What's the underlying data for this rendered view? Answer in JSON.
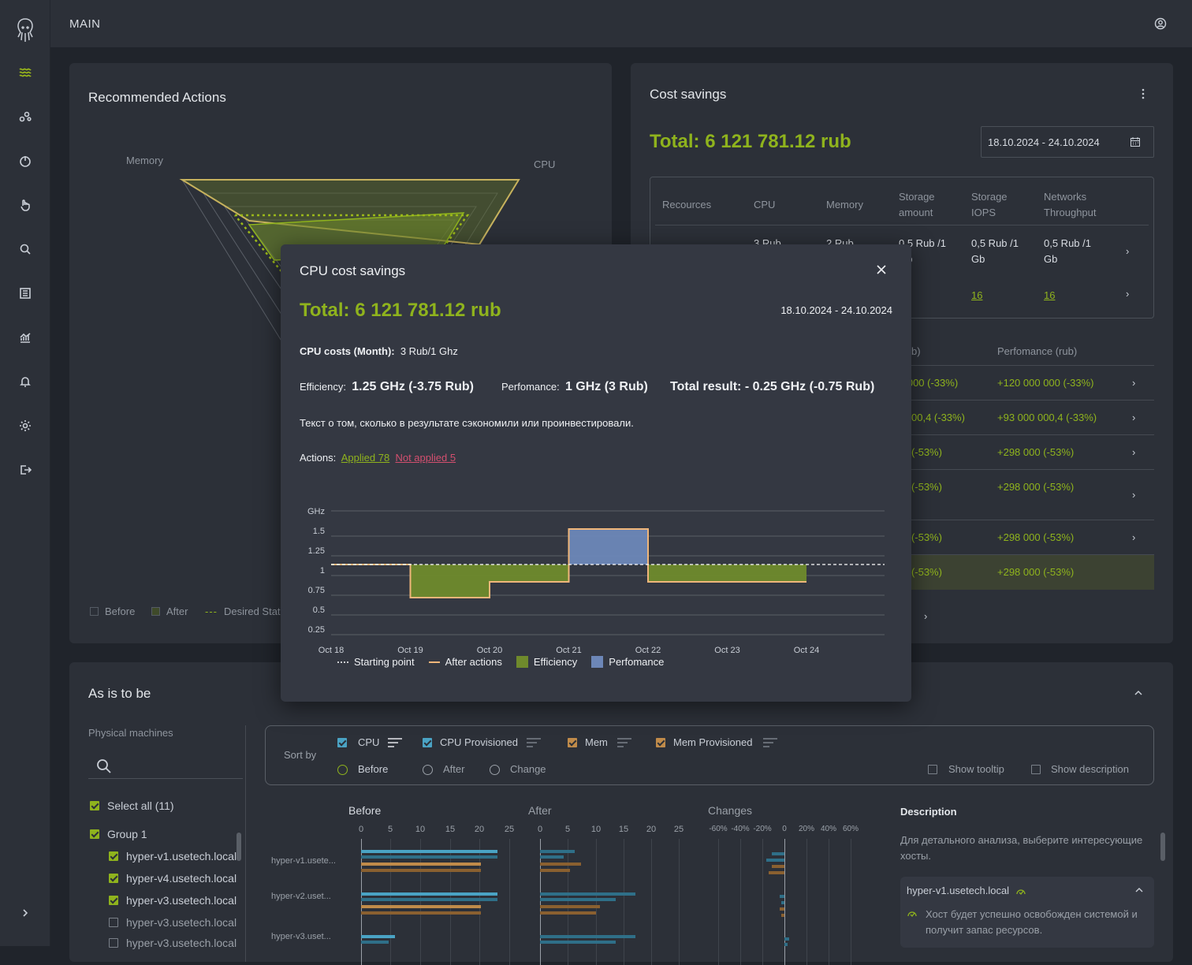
{
  "header": {
    "title": "MAIN"
  },
  "recommended": {
    "title": "Recommended Actions",
    "axis_memory": "Memory",
    "axis_cpu": "CPU",
    "legend": {
      "before": "Before",
      "after": "After",
      "desired": "Desired Stat"
    }
  },
  "cost": {
    "title": "Cost savings",
    "total": "Total: 6 121 781.12 rub",
    "date_range": "18.10.2024 -  24.10.2024",
    "table": {
      "headers": [
        "Recources",
        "CPU",
        "Memory",
        "Storage amount",
        "Storage IOPS",
        "Networks Throughput"
      ],
      "row1": {
        "cpu": "3 Rub",
        "memory": "2 Rub",
        "storage_amount": "0,5 Rub /1 Gb",
        "storage_iops": "0,5 Rub /1 Gb",
        "network": "0,5 Rub /1 Gb"
      },
      "row2": {
        "storage_iops": "16",
        "network": "16"
      }
    },
    "list_header_left": "y (rub)",
    "list_header_right": "Perfomance (rub)",
    "list": [
      {
        "left": "0 000 (-33%)",
        "right": "+120 000 000 (-33%)"
      },
      {
        "left": "00,4 (-33%)",
        "right": "+93 000 000,4 (-33%)"
      },
      {
        "left": ") (-53%)",
        "right": "+298 000 (-53%)"
      },
      {
        "left": ") (-53%)",
        "right": "+298 000 (-53%)"
      },
      {
        "left": ") (-53%)",
        "right": "+298 000 (-53%)"
      },
      {
        "left": ") (-53%)",
        "right": "+298 000 (-53%)"
      }
    ],
    "more": "/"
  },
  "asis": {
    "title": "As is to be",
    "physical_machines": "Physical machines",
    "select_all": "Select all (11)",
    "group": "Group 1",
    "hosts": [
      "hyper-v1.usetech.local",
      "hyper-v4.usetech.local",
      "hyper-v3.usetech.local",
      "hyper-v3.usetech.local",
      "hyper-v3.usetech.local"
    ],
    "sort_by": "Sort by",
    "sort_opts": {
      "cpu": "CPU",
      "cpu_prov": "CPU Provisioned",
      "mem": "Mem",
      "mem_prov": "Mem Provisioned"
    },
    "radios": {
      "before": "Before",
      "after": "After",
      "change": "Change"
    },
    "show_tooltip": "Show tooltip",
    "show_description": "Show description",
    "chart_titles": {
      "before": "Before",
      "after": "After",
      "changes": "Changes"
    },
    "before_ticks": [
      "0",
      "5",
      "10",
      "15",
      "20",
      "25"
    ],
    "after_ticks": [
      "0",
      "5",
      "10",
      "15",
      "20",
      "25"
    ],
    "change_ticks": [
      "-60%",
      "-40%",
      "-20%",
      "0",
      "20%",
      "40%",
      "60%"
    ],
    "row_labels": [
      "hyper-v1.usete...",
      "hyper-v2.uset...",
      "hyper-v3.uset..."
    ],
    "description_title": "Description",
    "description_text": "Для детального анализа, выберите интересующие хосты.",
    "desc_host": "hyper-v1.usetech.local",
    "desc_host_text": "Хост будет успешно освобожден системой и получит запас ресурсов."
  },
  "modal": {
    "title": "CPU cost savings",
    "total": "Total: 6 121 781.12 rub",
    "date_range": "18.10.2024 -  24.10.2024",
    "cpu_costs_label": "CPU costs (Month):",
    "cpu_costs_value": "3 Rub/1 Ghz",
    "efficiency_label": "Efficiency:",
    "efficiency_value": "1.25 GHz (-3.75 Rub)",
    "perf_label": "Perfomance:",
    "perf_value": "1 GHz (3 Rub)",
    "total_result": "Total result: - 0.25 GHz (-0.75 Rub)",
    "note": "Текст о том, сколько в результате сэкономили или проинвестировали.",
    "actions_label": "Actions:",
    "applied": "Applied 78",
    "not_applied": "Not applied 5"
  },
  "chart_data": {
    "type": "line",
    "ylabel": "GHz",
    "yticks": [
      "1.5",
      "1.25",
      "1",
      "0.75",
      "0.5",
      "0.25"
    ],
    "categories": [
      "Oct 18",
      "Oct 19",
      "Oct 20",
      "Oct 21",
      "Oct 22",
      "Oct 23",
      "Oct 24"
    ],
    "starting_point": 1.0,
    "after_actions_steps": [
      {
        "from": "Oct 18",
        "to": "Oct 19",
        "value": 1.0
      },
      {
        "from": "Oct 19",
        "to": "Oct 20",
        "value": 0.58
      },
      {
        "from": "Oct 20",
        "to": "Oct 21",
        "value": 0.78
      },
      {
        "from": "Oct 21",
        "to": "Oct 22",
        "value": 1.45
      },
      {
        "from": "Oct 22",
        "to": "Oct 24",
        "value": 0.78
      }
    ],
    "legend": [
      "Starting point",
      "After actions",
      "Efficiency",
      "Perfomance"
    ],
    "colors": {
      "after": "#f0b67a",
      "efficiency": "#6f8a2c",
      "performance": "#6d87b8",
      "start": "#ffffff"
    }
  }
}
